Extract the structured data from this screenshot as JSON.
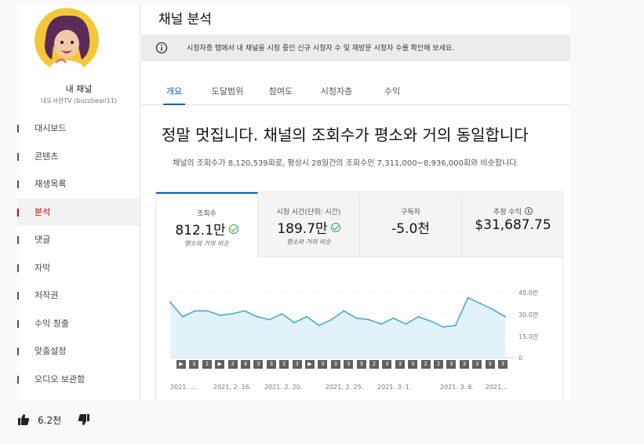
{
  "sidebar": {
    "channel_name": "내 채널",
    "channel_handle": "대도서관TV (buzzbean11)",
    "items": [
      {
        "label": "대시보드"
      },
      {
        "label": "콘텐츠"
      },
      {
        "label": "재생목록"
      },
      {
        "label": "분석"
      },
      {
        "label": "댓글"
      },
      {
        "label": "자막"
      },
      {
        "label": "저작권"
      },
      {
        "label": "수익 창출"
      },
      {
        "label": "맞춤설정"
      },
      {
        "label": "오디오 보관함"
      }
    ],
    "active_index": 3
  },
  "header": {
    "title": "채널 분석",
    "banner": "시청자층 탭에서 내 채널을 시청 중인 신규 시청자 수 및 재방문 시청자 수를 확인해 보세요.",
    "banner_icon": "info-icon"
  },
  "tabs": [
    {
      "label": "개요"
    },
    {
      "label": "도달범위"
    },
    {
      "label": "참여도"
    },
    {
      "label": "시청자층"
    },
    {
      "label": "수익"
    }
  ],
  "summary": {
    "headline": "정말 멋집니다. 채널의 조회수가 평소와 거의 동일합니다",
    "subline": "채널의 조회수가 8,120,539회로, 평상시 28일간의 조회수인 7,311,000~8,936,000회와 비슷합니다."
  },
  "metrics": [
    {
      "label": "조회수",
      "value": "812.1만",
      "note": "평소와 거의 비슷",
      "status": "check"
    },
    {
      "label": "시청 시간(단위: 시간)",
      "value": "189.7만",
      "note": "평소와 거의 비슷",
      "status": "check"
    },
    {
      "label": "구독자",
      "value": "-5.0천",
      "note": "",
      "status": ""
    },
    {
      "label": "추정 수익",
      "value": "$31,687.75",
      "note": "",
      "status": "clock"
    }
  ],
  "chart_data": {
    "type": "area",
    "series": [
      {
        "values": [
          38,
          28,
          32,
          32,
          29,
          30,
          32,
          28,
          26,
          30,
          24,
          28,
          22,
          26,
          32,
          27,
          26,
          23,
          27,
          23,
          28,
          25,
          21,
          22,
          41,
          37,
          33,
          28
        ]
      }
    ],
    "x_tick_labels": [
      "2021. ...",
      "2021. 2. 16.",
      "2021. 2. 20.",
      "2021. 2. 25.",
      "2021. 3. 1.",
      "2021. 3. 6.",
      "2021..."
    ],
    "y_tick_labels": [
      "45.0만",
      "30.0만",
      "15.0만",
      "0"
    ],
    "ylim": [
      0,
      45
    ],
    "line_color": "#48a9d6",
    "fill_color": "#e2f2f9",
    "video_markers": [
      "▶",
      "3",
      "2",
      "▶",
      "2",
      "4",
      "3",
      "3",
      "2",
      "3",
      "▶",
      "3",
      "3",
      "3",
      "3",
      "2",
      "3",
      "3",
      "3",
      "2",
      "2",
      "3",
      "3",
      "3",
      "3",
      "3"
    ]
  },
  "reactions": {
    "like_count": "6.2천",
    "like_icon": "thumbs-up-icon",
    "dislike_icon": "thumbs-down-icon"
  },
  "colors": {
    "accent": "#065fd4",
    "active_nav": "#cc0000",
    "positive": "#2ba640"
  }
}
